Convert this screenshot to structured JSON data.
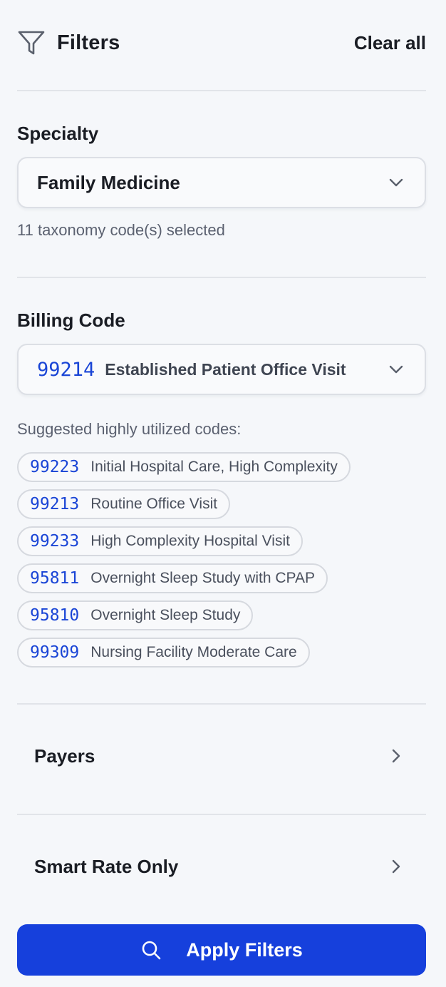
{
  "header": {
    "title": "Filters",
    "clear_all_label": "Clear all",
    "icon": "filter-icon"
  },
  "specialty": {
    "label": "Specialty",
    "selected": "Family Medicine",
    "hint": "11 taxonomy code(s) selected"
  },
  "billing": {
    "label": "Billing Code",
    "selected_code": "99214",
    "selected_desc": "Established Patient Office Visit",
    "suggested_label": "Suggested highly utilized codes:",
    "suggestions": [
      {
        "code": "99223",
        "label": "Initial Hospital Care, High Complexity"
      },
      {
        "code": "99213",
        "label": "Routine Office Visit"
      },
      {
        "code": "99233",
        "label": "High Complexity Hospital Visit"
      },
      {
        "code": "95811",
        "label": "Overnight Sleep Study with CPAP"
      },
      {
        "code": "95810",
        "label": "Overnight Sleep Study"
      },
      {
        "code": "99309",
        "label": "Nursing Facility Moderate Care"
      }
    ]
  },
  "payers": {
    "label": "Payers"
  },
  "smart_rate": {
    "label": "Smart Rate Only"
  },
  "apply": {
    "label": "Apply Filters",
    "icon": "search-icon"
  },
  "colors": {
    "accent": "#1640dc",
    "code_text": "#1a45d6",
    "background": "#f5f7fa"
  }
}
